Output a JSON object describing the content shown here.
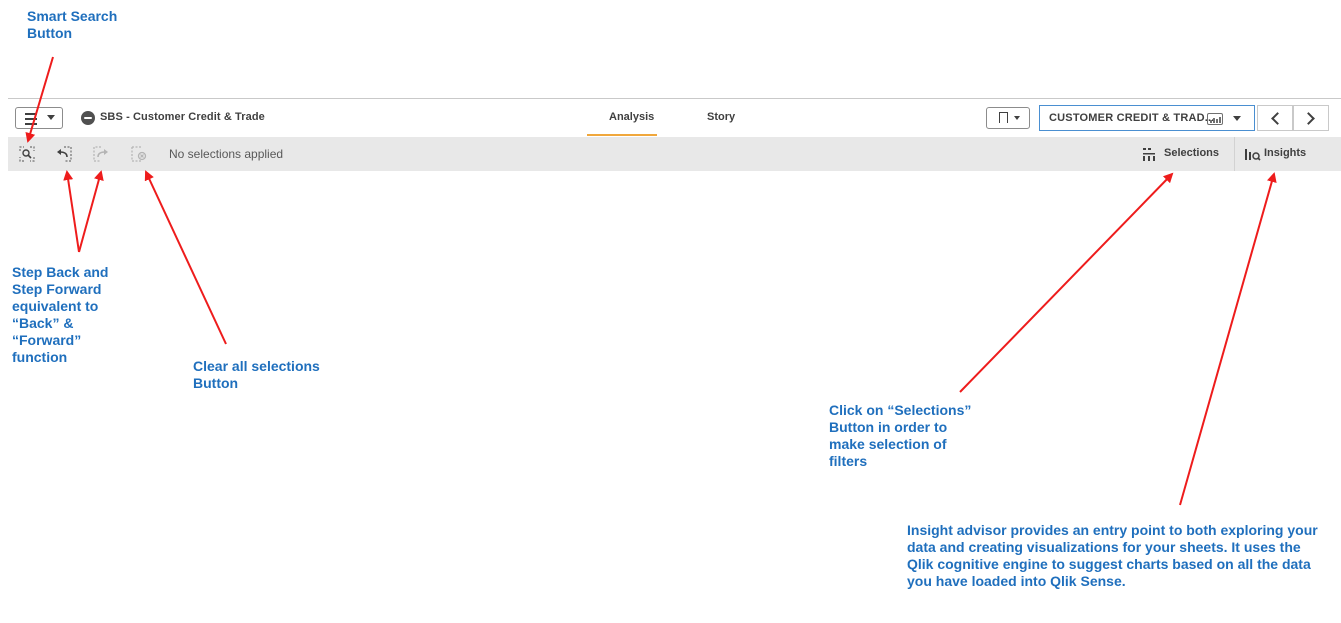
{
  "annotations": {
    "smart_search": "Smart Search\nButton",
    "step": "Step Back and\nStep Forward\nequivalent to\n“Back” &\n“Forward”\nfunction",
    "clear_all": "Clear all selections\nButton",
    "selections": "Click on “Selections”\nButton in order to\nmake selection of\nfilters",
    "insights": "Insight advisor provides an entry point to both exploring your data and creating visualizations for your sheets. It uses the Qlik cognitive engine to suggest charts based on all the data you have loaded into Qlik Sense."
  },
  "toolbar": {
    "app_title": "SBS - Customer Credit & Trade",
    "tabs": [
      {
        "label": "Analysis",
        "active": true
      },
      {
        "label": "Story",
        "active": false
      }
    ],
    "sheet_name": "CUSTOMER CREDIT & TRAD...",
    "accent_color": "#f0a73c"
  },
  "selection_bar": {
    "status_text": "No selections applied",
    "selections_label": "Selections",
    "insights_label": "Insights"
  },
  "icons": {
    "menu": "hamburger-icon",
    "app": "app-icon",
    "bookmark": "bookmark-icon",
    "sheet": "sheet-icon",
    "prev": "chevron-left-icon",
    "next": "chevron-right-icon",
    "smart_search": "smart-search-icon",
    "step_back": "step-back-icon",
    "step_forward": "step-forward-icon",
    "clear_all": "clear-selections-icon",
    "selections": "selections-icon",
    "insights": "insights-icon"
  },
  "colors": {
    "annotation_text": "#1f6fbd",
    "annotation_arrow": "#ee1c1c",
    "selection_bar_bg": "#e8e8e8"
  }
}
